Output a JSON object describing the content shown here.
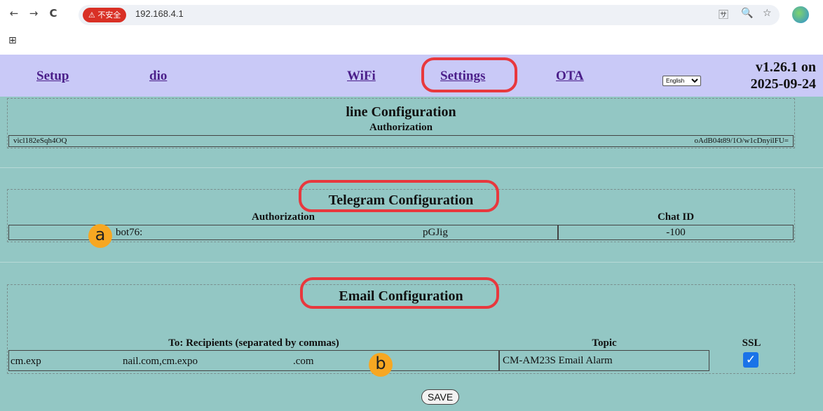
{
  "browser": {
    "back_icon": "←",
    "forward_icon": "→",
    "reload_icon": "C",
    "insecure_label": "⚠ 不安全",
    "url": "192.168.4.1",
    "translate_icon": "🈂",
    "zoom_icon": "🔍",
    "bookmark_icon": "☆",
    "apps_icon": "⊞"
  },
  "nav": {
    "setup": "Setup",
    "dio": "dio",
    "wifi": "WiFi",
    "settings": "Settings",
    "ota": "OTA",
    "language": "English",
    "version_line1": "v1.26.1 on",
    "version_line2": "2025-09-24"
  },
  "line": {
    "title": "line Configuration",
    "auth_label": "Authorization",
    "auth_value_start": "vicl182eSqh4OQ",
    "auth_value_end": "oAdB04t89/1O/w1cDnyilFU="
  },
  "telegram": {
    "title": "Telegram Configuration",
    "auth_label": "Authorization",
    "chat_label": "Chat ID",
    "auth_value_start": "bot76:",
    "auth_value_end": "pGJig",
    "chat_value": "-100"
  },
  "email": {
    "title": "Email Configuration",
    "to_label": "To: Recipients (separated by commas)",
    "topic_label": "Topic",
    "ssl_label": "SSL",
    "to_value_part1": "cm.exp",
    "to_value_part2": "nail.com,cm.expo",
    "to_value_part3": ".com",
    "topic_value": "CM-AM23S Email Alarm",
    "ssl_checked": true
  },
  "markers": {
    "a": "a",
    "b": "b"
  },
  "save_label": "SAVE",
  "colors": {
    "page_bg": "#93c7c4",
    "nav_bg": "#c9c9f7",
    "link": "#4b1f8a",
    "highlight": "#e8383d",
    "marker": "#f7a722"
  }
}
